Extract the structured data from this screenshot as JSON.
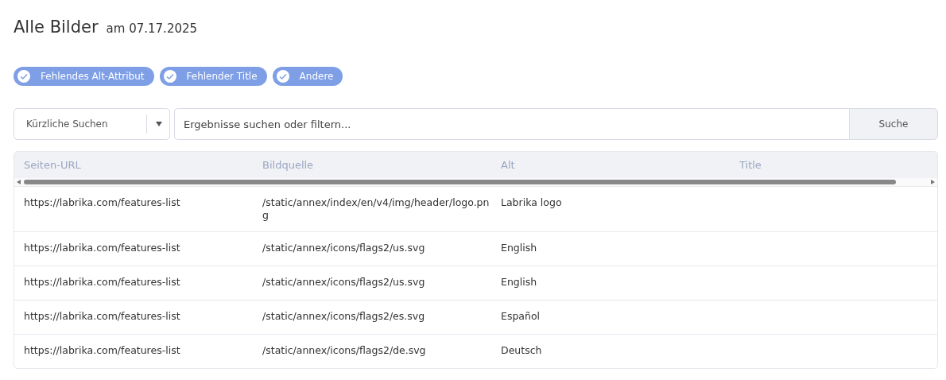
{
  "header": {
    "title": "Alle Bilder",
    "date": "am 07.17.2025"
  },
  "filters": [
    {
      "label": "Fehlendes Alt-Attribut",
      "checked": true
    },
    {
      "label": "Fehlender Title",
      "checked": true
    },
    {
      "label": "Andere",
      "checked": true
    }
  ],
  "search": {
    "recent_label": "Kürzliche Suchen",
    "placeholder": "Ergebnisse suchen oder filtern...",
    "button": "Suche"
  },
  "table": {
    "columns": [
      "Seiten-URL",
      "Bildquelle",
      "Alt",
      "Title"
    ],
    "rows": [
      [
        "https://labrika.com/features-list",
        "/static/annex/index/en/v4/img/header/logo.png",
        "Labrika logo"
      ],
      [
        "https://labrika.com/features-list",
        "/static/annex/icons/flags2/us.svg",
        "English"
      ],
      [
        "https://labrika.com/features-list",
        "/static/annex/icons/flags2/us.svg",
        "English"
      ],
      [
        "https://labrika.com/features-list",
        "/static/annex/icons/flags2/es.svg",
        "Español"
      ],
      [
        "https://labrika.com/features-list",
        "/static/annex/icons/flags2/de.svg",
        "Deutsch"
      ]
    ]
  }
}
